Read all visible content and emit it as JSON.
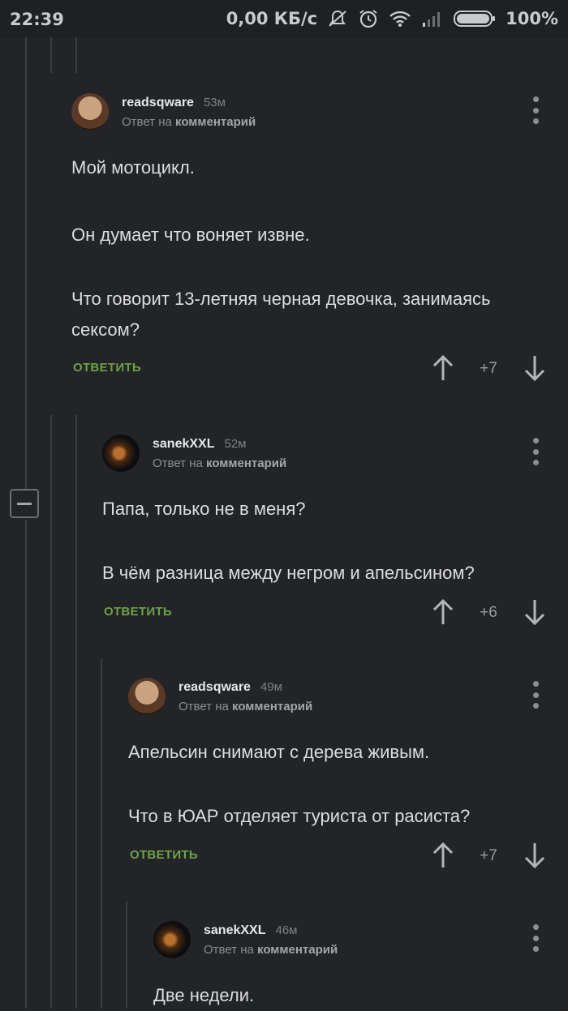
{
  "status_bar": {
    "time": "22:39",
    "network_speed": "0,00 КБ/с",
    "battery": "100%",
    "icons": [
      "mute-icon",
      "alarm-icon",
      "wifi-icon",
      "signal-icon",
      "battery-icon"
    ]
  },
  "comments": [
    {
      "author": "readsqware",
      "time": "53м",
      "reply_prefix": "Ответ на",
      "reply_target": "комментарий",
      "paragraphs": [
        "Мой мотоцикл.",
        "Он думает что воняет извне.",
        "Что говорит 13-летняя черная девочка, занимаясь сексом?"
      ],
      "reply_label": "ОТВЕТИТЬ",
      "score": "+7"
    },
    {
      "author": "sanekXXL",
      "time": "52м",
      "reply_prefix": "Ответ на",
      "reply_target": "комментарий",
      "paragraphs": [
        "Папа, только не в меня?",
        "В чём разница между негром и апельсином?"
      ],
      "reply_label": "ОТВЕТИТЬ",
      "score": "+6"
    },
    {
      "author": "readsqware",
      "time": "49м",
      "reply_prefix": "Ответ на",
      "reply_target": "комментарий",
      "paragraphs": [
        "Апельсин снимают с дерева живым.",
        "Что в ЮАР отделяет туриста от расиста?"
      ],
      "reply_label": "ОТВЕТИТЬ",
      "score": "+7"
    },
    {
      "author": "sanekXXL",
      "time": "46м",
      "reply_prefix": "Ответ на",
      "reply_target": "комментарий",
      "paragraphs": [
        "Две недели."
      ]
    }
  ],
  "colors": {
    "background": "#222427",
    "reply_action": "#6fa147",
    "thread_line": "#3a3d42"
  }
}
